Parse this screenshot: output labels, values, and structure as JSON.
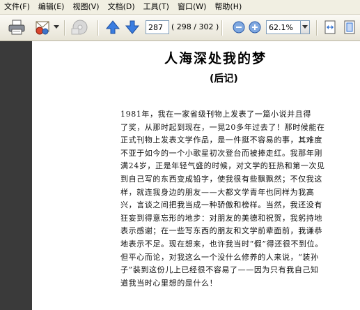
{
  "menu": [
    "文件(F)",
    "编辑(E)",
    "视图(V)",
    "文档(D)",
    "工具(T)",
    "窗口(W)",
    "帮助(H)"
  ],
  "toolbar": {
    "current_page": "287",
    "page_count": "( 298 / 302 )",
    "zoom": "62.1%"
  },
  "document": {
    "title": "人海深处我的梦",
    "subtitle": "(后记)",
    "lines": [
      "    1981年，我在一家省级刊物上发表了一篇小说并且得",
      "了奖，从那时起到现在，一晃20多年过去了！那时候能在",
      "正式刊物上发表文学作品，是一件挺不容易的事，其难度",
      "不亚于如今的一个小歌星初次登台而被捧走红。我那年刚",
      "满24岁，正是年轻气盛的时候，对文学的狂热和第一次见",
      "到自己写的东西变成铅字，使我很有些飘飘然；不仅我这",
      "样，就连我身边的朋友——大都文学青年也同样为我高",
      "兴，言谈之间把我当成一种骄傲和榜样。当然，我还没有",
      "狂妄到得意忘形的地步：对朋友的美德和祝贺，我躬持地",
      "表示感谢；在一些写东西的朋友和文学前辈面前，我谦恭",
      "地表示不足。现在想来，也许我当时“假”得还很不到位。",
      "但平心而论，对我这么一个没什么修养的人来说，“装孙",
      "子”装到这份儿上已经很不容易了——因为只有我自己知",
      "道我当时心里想的是什么！"
    ]
  },
  "colors": {
    "menubar": "#f1efe2",
    "left_panel": "#3a3a3a",
    "nav_arrow": "#2e6fd0"
  },
  "icons": [
    "print-icon",
    "email-icon",
    "disk-icon",
    "prev-page-icon",
    "next-page-icon",
    "zoom-out-icon",
    "zoom-in-icon",
    "fit-width-icon",
    "fit-page-icon"
  ]
}
